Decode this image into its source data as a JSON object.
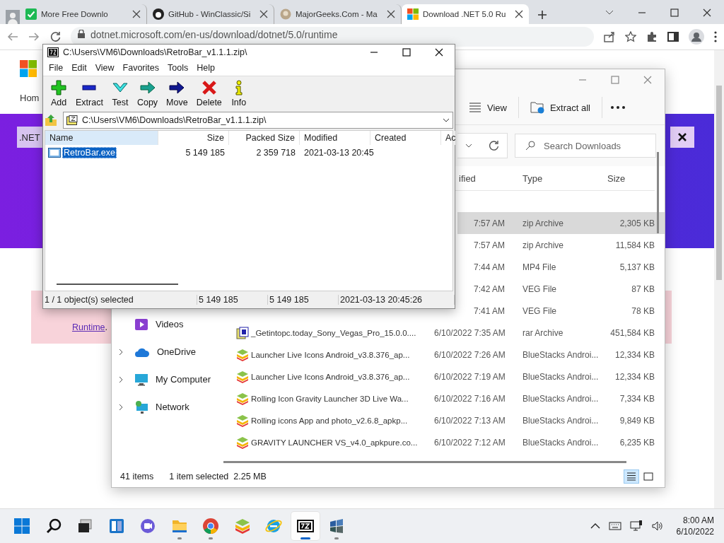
{
  "browser": {
    "tabs": [
      {
        "title": "More Free Downlo",
        "selected": false
      },
      {
        "title": "GitHub - WinClassic/Si",
        "selected": false
      },
      {
        "title": "MajorGeeks.Com - Ma",
        "selected": false
      },
      {
        "title": "Download .NET 5.0 Ru",
        "selected": true
      }
    ],
    "url": "dotnet.microsoft.com/en-us/download/dotnet/5.0/runtime"
  },
  "page": {
    "nav_text": "Hom",
    "banner_chip": ".NET",
    "notice_link": "Runtime",
    "notice_text": "."
  },
  "explorer": {
    "toolbar": [
      {
        "label": "View",
        "kind": "view"
      },
      {
        "label": "Extract all",
        "kind": "extract"
      }
    ],
    "search": {
      "placeholder": "Search Downloads"
    },
    "columns": [
      "ified",
      "Type",
      "Size"
    ],
    "nav": [
      {
        "label": "Videos",
        "expandable": false
      },
      {
        "label": "OneDrive",
        "expandable": true
      },
      {
        "label": "My Computer",
        "expandable": true
      },
      {
        "label": "Network",
        "expandable": true
      }
    ],
    "rows": [
      {
        "kind": "covered",
        "date": "7:57 AM",
        "type": "zip Archive",
        "size": "2,305 KB",
        "selected": true
      },
      {
        "kind": "covered",
        "date": "7:57 AM",
        "type": "zip Archive",
        "size": "11,584 KB",
        "selected": false
      },
      {
        "kind": "covered",
        "date": "7:44 AM",
        "type": "MP4 File",
        "size": "5,137 KB",
        "selected": false
      },
      {
        "kind": "covered",
        "date": "7:42 AM",
        "type": "VEG File",
        "size": "87 KB",
        "selected": false
      },
      {
        "kind": "covered",
        "date": "7:41 AM",
        "type": "VEG File",
        "size": "78 KB",
        "selected": false
      },
      {
        "kind": "rar",
        "name": "_Getintopc.today_Sony_Vegas_Pro_15.0.0....",
        "date": "6/10/2022 7:35 AM",
        "type": "rar Archive",
        "size": "451,584 KB",
        "selected": false
      },
      {
        "kind": "stack",
        "name": "Launcher Live Icons Android_v3.8.376_ap...",
        "date": "6/10/2022 7:26 AM",
        "type": "BlueStacks Androi...",
        "size": "12,334 KB",
        "selected": false
      },
      {
        "kind": "stack",
        "name": "Launcher Live Icons Android_v3.8.376_ap...",
        "date": "6/10/2022 7:19 AM",
        "type": "BlueStacks Androi...",
        "size": "12,334 KB",
        "selected": false
      },
      {
        "kind": "stack",
        "name": "Rolling Icon Gravity Launcher 3D Live Wa...",
        "date": "6/10/2022 7:16 AM",
        "type": "BlueStacks Androi...",
        "size": "7,334 KB",
        "selected": false
      },
      {
        "kind": "stack",
        "name": "Rolling icons App and photo_v2.6.8_apkp...",
        "date": "6/10/2022 7:13 AM",
        "type": "BlueStacks Androi...",
        "size": "9,849 KB",
        "selected": false
      },
      {
        "kind": "stack",
        "name": "GRAVITY LAUNCHER VS_v4.0_apkpure.co...",
        "date": "6/10/2022 7:12 AM",
        "type": "BlueStacks Androi...",
        "size": "6,235 KB",
        "selected": false
      }
    ],
    "status": {
      "count": "41 items",
      "selection": "1 item selected",
      "size": "2.25 MB"
    },
    "views": [
      {
        "kind": "details",
        "selected": true
      },
      {
        "kind": "tiles",
        "selected": false
      }
    ]
  },
  "sevenzip": {
    "title": "C:\\Users\\VM6\\Downloads\\RetroBar_v1.1.1.zip\\",
    "menu": [
      "File",
      "Edit",
      "View",
      "Favorites",
      "Tools",
      "Help"
    ],
    "toolbar": [
      {
        "label": "Add",
        "kind": "add"
      },
      {
        "label": "Extract",
        "kind": "extract"
      },
      {
        "label": "Test",
        "kind": "test"
      },
      {
        "label": "Copy",
        "kind": "copy"
      },
      {
        "label": "Move",
        "kind": "move"
      },
      {
        "label": "Delete",
        "kind": "delete"
      },
      {
        "label": "Info",
        "kind": "info"
      }
    ],
    "path": "C:\\Users\\VM6\\Downloads\\RetroBar_v1.1.1.zip\\",
    "columns": [
      {
        "label": "Name",
        "selected": true
      },
      {
        "label": "Size",
        "selected": false
      },
      {
        "label": "Packed Size",
        "selected": false
      },
      {
        "label": "Modified",
        "selected": false
      },
      {
        "label": "Created",
        "selected": false
      },
      {
        "label": "Ac",
        "selected": false
      }
    ],
    "rows": [
      {
        "cells": [
          "RetroBar.exe",
          "5 149 185",
          "2 359 718",
          "2021-03-13 20:45"
        ],
        "selected": true
      }
    ],
    "status": [
      "1 / 1 object(s) selected",
      "5 149 185",
      "5 149 185",
      "2021-03-13 20:45:26"
    ]
  },
  "taskbar": {
    "apps": [
      {
        "kind": "start",
        "running": false,
        "selected": false
      },
      {
        "kind": "search",
        "running": false,
        "selected": false
      },
      {
        "kind": "taskview",
        "running": false,
        "selected": false
      },
      {
        "kind": "widgets",
        "running": false,
        "selected": false
      },
      {
        "kind": "chat",
        "running": false,
        "selected": false
      },
      {
        "kind": "folder",
        "running": true,
        "selected": false
      },
      {
        "kind": "chrome",
        "running": true,
        "selected": false
      },
      {
        "kind": "stack",
        "running": false,
        "selected": false
      },
      {
        "kind": "ie",
        "running": false,
        "selected": false
      },
      {
        "kind": "sevenzip",
        "running": true,
        "selected": true
      },
      {
        "kind": "winflag",
        "running": true,
        "selected": false
      }
    ],
    "clock": {
      "time": "8:00 AM",
      "date": "6/10/2022"
    }
  }
}
